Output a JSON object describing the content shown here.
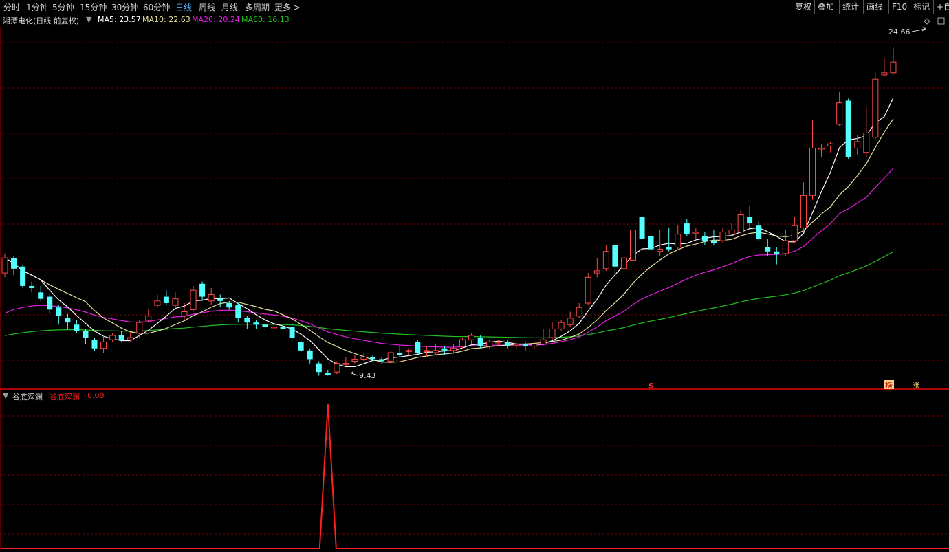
{
  "toolbar": {
    "periods": [
      "分时",
      "1分钟",
      "5分钟",
      "15分钟",
      "30分钟",
      "60分钟",
      "日线",
      "周线",
      "月线",
      "多周期",
      "更多 >"
    ],
    "active_period": "日线",
    "right_buttons": [
      "复权",
      "叠加",
      "统计",
      "画线",
      "F10",
      "标记",
      "+自"
    ]
  },
  "header": {
    "stock_title": "湘潭电化(日线 前复权)",
    "ma5_label": "MA5: 23.57",
    "ma10_label": "MA10: 22.63",
    "ma20_label": "MA20: 20.24",
    "ma60_label": "MA60: 16.13"
  },
  "colors": {
    "up": "#ff4a4a",
    "down": "#54ffff",
    "ma5": "#ffffff",
    "ma10": "#e8e0a0",
    "ma20": "#e020e0",
    "ma60": "#20c020",
    "grid": "#7a0000",
    "indicator": "#ff2020"
  },
  "annotations": {
    "high_label": "24.66",
    "low_label": "9.43",
    "signal_s": "S",
    "tag_1": "榜",
    "tag_2": "涨"
  },
  "indicator": {
    "name": "谷底深渊",
    "value_label": "谷底深渊",
    "value": "0.00"
  },
  "chart_data": {
    "type": "candlestick",
    "price_range": [
      9.0,
      25.6
    ],
    "high": 24.66,
    "low": 9.43,
    "candles": [
      [
        14.2,
        14.9,
        15.1,
        14.0
      ],
      [
        14.9,
        14.4,
        15.0,
        14.1
      ],
      [
        14.5,
        13.6,
        14.6,
        13.5
      ],
      [
        13.6,
        13.5,
        13.8,
        13.3
      ],
      [
        13.3,
        13.0,
        13.6,
        12.9
      ],
      [
        13.1,
        12.5,
        13.2,
        12.3
      ],
      [
        12.6,
        12.2,
        12.7,
        11.8
      ],
      [
        12.1,
        11.9,
        12.3,
        11.6
      ],
      [
        11.8,
        11.5,
        12.0,
        11.4
      ],
      [
        11.5,
        11.2,
        11.6,
        10.9
      ],
      [
        11.1,
        10.7,
        11.2,
        10.6
      ],
      [
        10.7,
        11.0,
        11.3,
        10.5
      ],
      [
        11.1,
        11.3,
        11.4,
        11.0
      ],
      [
        11.3,
        11.1,
        11.5,
        11.0
      ],
      [
        11.1,
        11.2,
        11.4,
        11.0
      ],
      [
        11.4,
        11.9,
        12.0,
        11.2
      ],
      [
        12.0,
        12.2,
        12.5,
        11.9
      ],
      [
        12.7,
        12.9,
        13.2,
        12.6
      ],
      [
        13.1,
        12.8,
        13.4,
        12.7
      ],
      [
        12.7,
        13.0,
        13.3,
        12.5
      ],
      [
        12.2,
        12.4,
        12.8,
        12.0
      ],
      [
        12.5,
        13.4,
        13.6,
        12.4
      ],
      [
        13.7,
        13.1,
        13.8,
        12.9
      ],
      [
        12.9,
        13.2,
        13.5,
        12.7
      ],
      [
        13.0,
        12.9,
        13.2,
        12.6
      ],
      [
        12.8,
        12.6,
        12.9,
        12.5
      ],
      [
        12.7,
        12.1,
        12.8,
        11.9
      ],
      [
        12.1,
        11.9,
        12.2,
        11.6
      ],
      [
        11.9,
        11.8,
        12.0,
        11.6
      ],
      [
        11.8,
        11.7,
        11.9,
        11.5
      ],
      [
        11.7,
        11.7,
        11.8,
        11.6
      ],
      [
        11.7,
        11.6,
        11.8,
        11.2
      ],
      [
        11.7,
        11.2,
        11.9,
        11.0
      ],
      [
        11.0,
        10.6,
        11.1,
        10.5
      ],
      [
        10.6,
        10.2,
        10.7,
        10.0
      ],
      [
        10.0,
        9.6,
        10.1,
        9.43
      ],
      [
        9.55,
        9.45,
        9.7,
        9.43
      ],
      [
        9.6,
        10.0,
        10.1,
        9.5
      ],
      [
        10.0,
        10.0,
        10.3,
        9.9
      ],
      [
        10.1,
        10.2,
        10.4,
        10.0
      ],
      [
        10.2,
        10.3,
        10.5,
        10.1
      ],
      [
        10.3,
        10.2,
        10.4,
        10.1
      ],
      [
        10.2,
        10.1,
        10.3,
        10.0
      ],
      [
        10.1,
        10.5,
        10.6,
        10.0
      ],
      [
        10.5,
        10.4,
        10.8,
        10.3
      ],
      [
        10.6,
        10.6,
        10.7,
        10.4
      ],
      [
        11.0,
        10.5,
        11.1,
        10.4
      ],
      [
        10.6,
        10.6,
        10.8,
        10.3
      ],
      [
        10.5,
        10.6,
        10.9,
        10.4
      ],
      [
        10.7,
        10.6,
        10.8,
        10.4
      ],
      [
        10.6,
        10.7,
        10.9,
        10.5
      ],
      [
        10.8,
        11.1,
        11.2,
        10.7
      ],
      [
        11.1,
        11.3,
        11.4,
        10.9
      ],
      [
        11.2,
        10.8,
        11.3,
        10.7
      ],
      [
        10.8,
        11.0,
        11.1,
        10.7
      ],
      [
        11.0,
        11.0,
        11.1,
        10.8
      ],
      [
        11.0,
        10.8,
        11.1,
        10.7
      ],
      [
        10.9,
        10.9,
        11.0,
        10.7
      ],
      [
        10.9,
        10.8,
        11.0,
        10.6
      ],
      [
        10.8,
        10.9,
        11.0,
        10.7
      ],
      [
        10.9,
        11.1,
        11.6,
        10.8
      ],
      [
        11.2,
        11.6,
        11.9,
        11.1
      ],
      [
        11.6,
        11.9,
        12.0,
        11.5
      ],
      [
        11.8,
        12.1,
        12.4,
        11.7
      ],
      [
        12.2,
        12.6,
        12.8,
        12.1
      ],
      [
        12.8,
        14.0,
        14.2,
        12.7
      ],
      [
        14.2,
        14.3,
        14.9,
        14.0
      ],
      [
        14.4,
        15.2,
        15.5,
        14.3
      ],
      [
        15.5,
        14.5,
        15.6,
        14.2
      ],
      [
        14.4,
        14.9,
        15.0,
        14.3
      ],
      [
        14.8,
        16.2,
        16.8,
        14.7
      ],
      [
        16.8,
        15.8,
        16.9,
        15.6
      ],
      [
        15.9,
        15.3,
        16.0,
        15.2
      ],
      [
        15.2,
        15.3,
        16.2,
        15.0
      ],
      [
        15.4,
        15.3,
        16.3,
        15.2
      ],
      [
        15.4,
        16.0,
        16.4,
        15.3
      ],
      [
        16.5,
        16.0,
        16.7,
        15.9
      ],
      [
        16.1,
        16.1,
        16.3,
        15.8
      ],
      [
        15.9,
        15.7,
        16.1,
        15.5
      ],
      [
        15.7,
        15.6,
        16.2,
        15.5
      ],
      [
        15.7,
        16.1,
        16.3,
        15.6
      ],
      [
        16.0,
        16.2,
        16.5,
        15.9
      ],
      [
        16.1,
        16.9,
        17.1,
        16.0
      ],
      [
        16.8,
        16.5,
        17.3,
        16.3
      ],
      [
        16.4,
        15.8,
        16.6,
        15.7
      ],
      [
        15.4,
        15.2,
        15.8,
        15.0
      ],
      [
        15.2,
        15.1,
        15.4,
        14.6
      ],
      [
        15.1,
        15.7,
        16.2,
        15.0
      ],
      [
        15.7,
        16.4,
        16.8,
        15.6
      ],
      [
        16.3,
        17.8,
        18.4,
        16.1
      ],
      [
        17.8,
        20.0,
        21.3,
        17.6
      ],
      [
        20.0,
        20.0,
        20.2,
        19.6
      ],
      [
        20.1,
        20.2,
        20.3,
        19.8
      ],
      [
        21.1,
        22.1,
        22.6,
        21.0
      ],
      [
        22.2,
        19.6,
        22.3,
        19.5
      ],
      [
        20.0,
        20.3,
        20.6,
        19.7
      ],
      [
        19.8,
        20.7,
        21.9,
        19.6
      ],
      [
        20.5,
        23.2,
        23.5,
        20.4
      ],
      [
        23.4,
        23.5,
        24.2,
        23.3
      ],
      [
        23.5,
        24.0,
        24.66,
        23.4
      ]
    ],
    "indicator_series": "zero everywhere except a single spike to about 1.0 at candle index 36 (the 9.43 low)"
  }
}
